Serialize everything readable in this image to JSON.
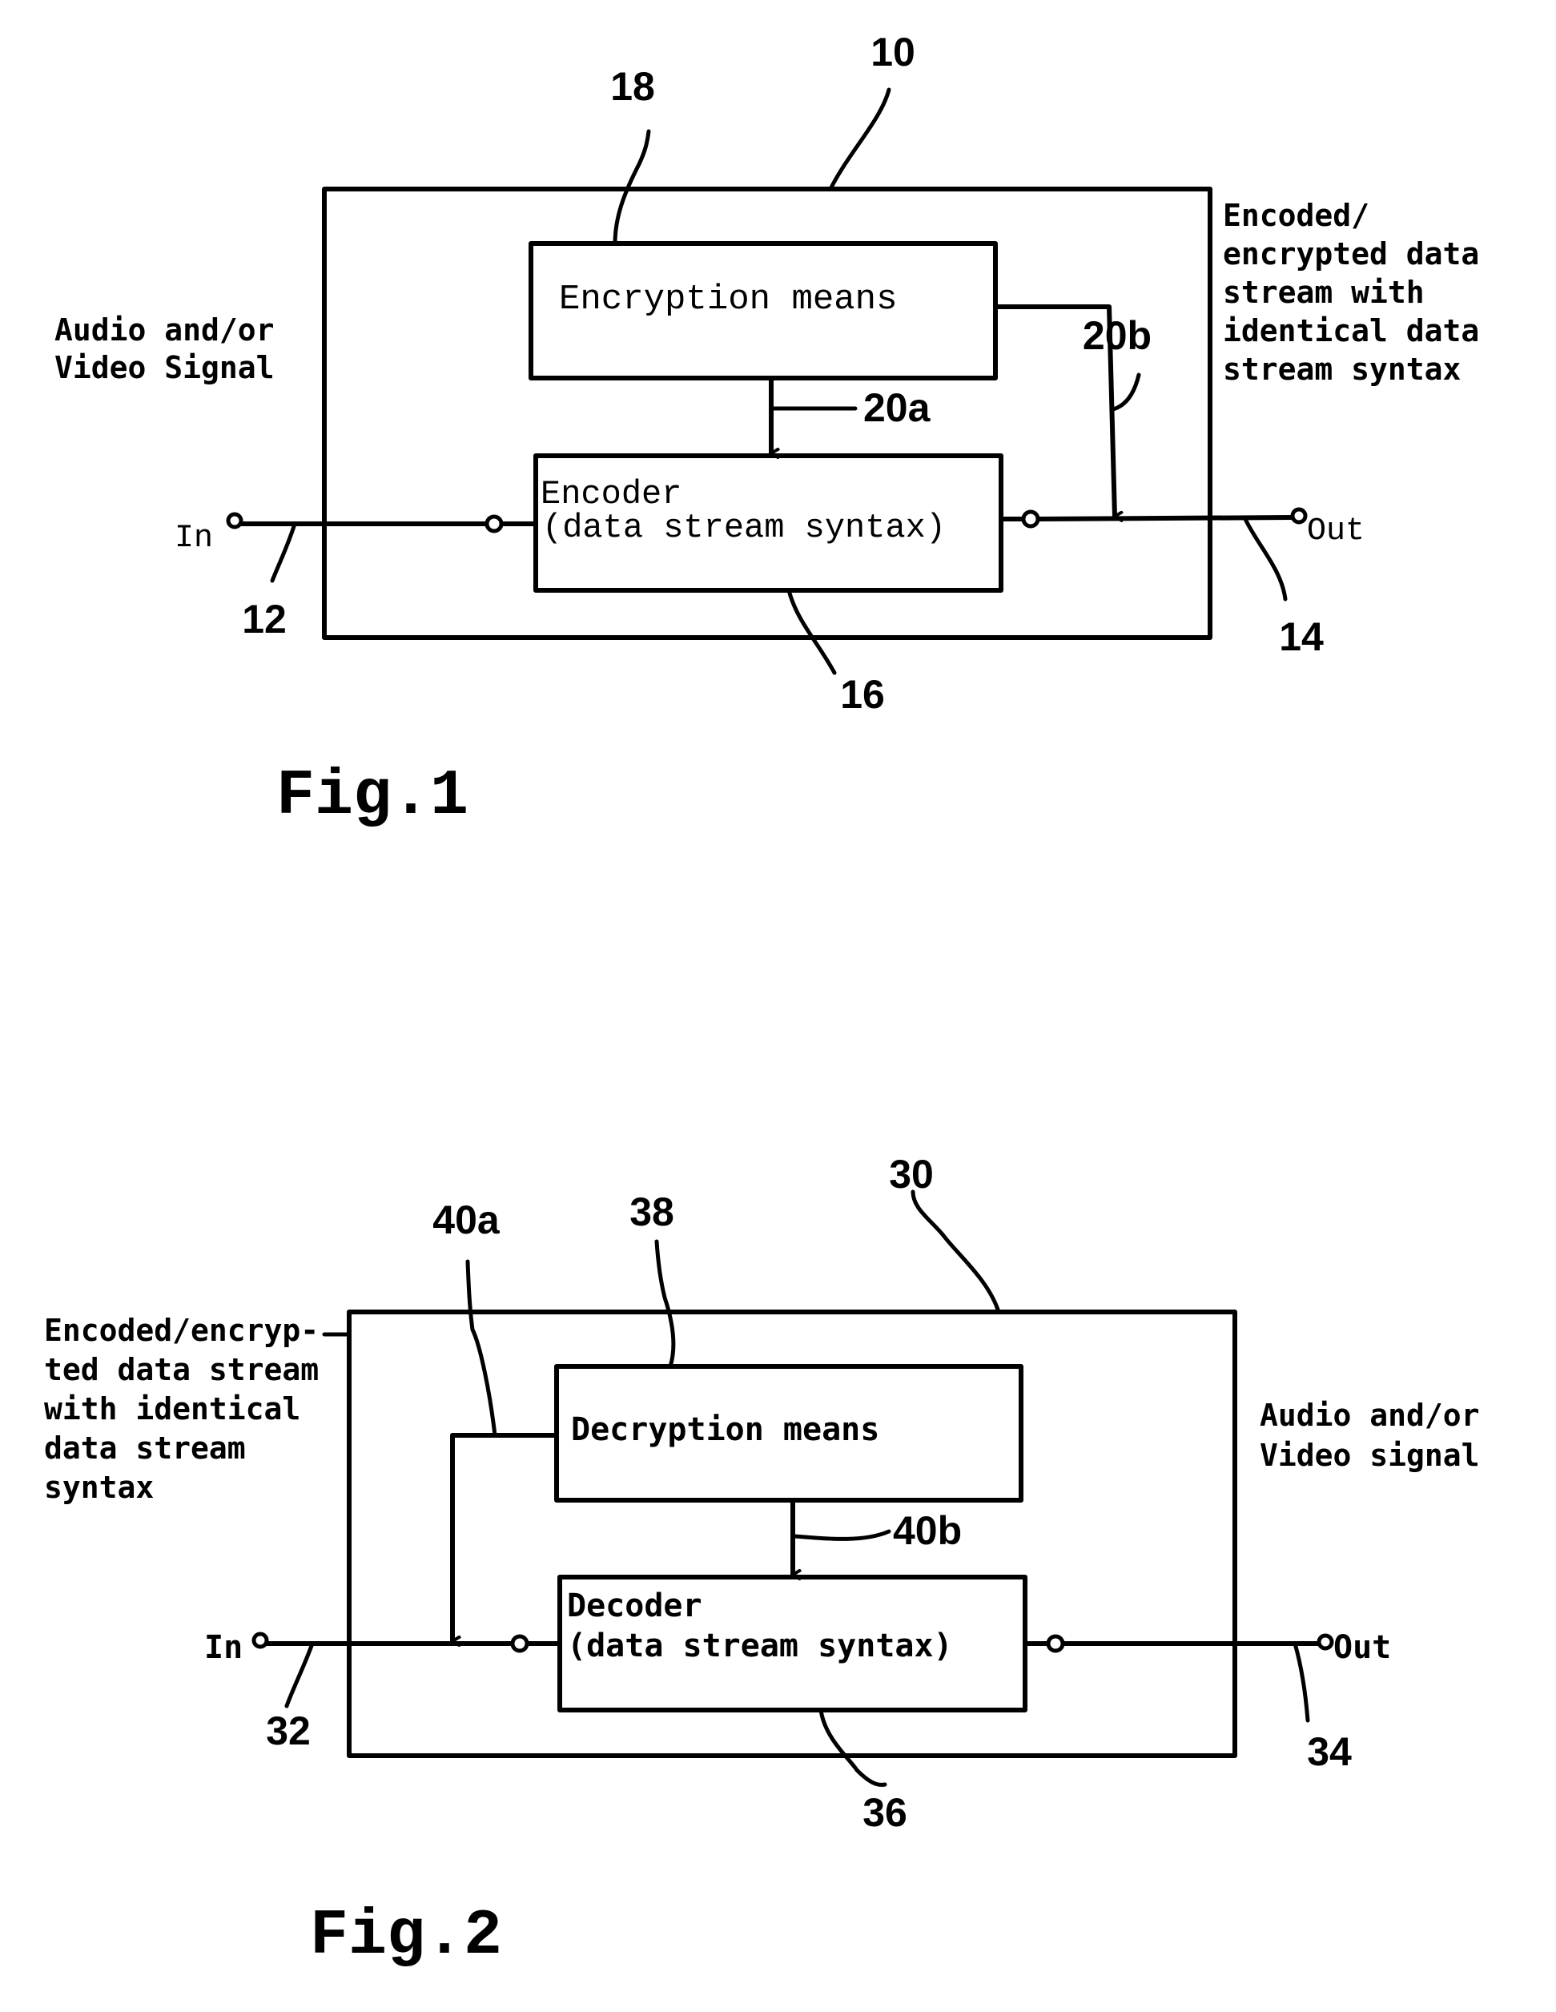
{
  "figure1": {
    "caption": "Fig.1",
    "refs": {
      "device": "10",
      "input": "12",
      "output": "14",
      "encoder": "16",
      "encryption": "18",
      "link_a": "20a",
      "link_b": "20b"
    },
    "blocks": {
      "encryption": "Encryption means",
      "encoder_line1": "Encoder",
      "encoder_line2": "(data stream syntax)"
    },
    "terminals": {
      "in": "In",
      "out": "Out"
    },
    "input_description": [
      "Audio and/or",
      "Video Signal"
    ],
    "output_description": [
      "Encoded/",
      "encrypted data",
      "stream with",
      "identical data",
      "stream syntax"
    ]
  },
  "figure2": {
    "caption": "Fig.2",
    "refs": {
      "device": "30",
      "input": "32",
      "output": "34",
      "decoder": "36",
      "decryption": "38",
      "link_a": "40a",
      "link_b": "40b"
    },
    "blocks": {
      "decryption": "Decryption means",
      "decoder_line1": "Decoder",
      "decoder_line2": "(data stream syntax)"
    },
    "terminals": {
      "in": "In",
      "out": "Out"
    },
    "input_description": [
      "Encoded/encryp-",
      "ted data stream",
      "with identical",
      "data stream",
      "syntax"
    ],
    "output_description": [
      "Audio and/or",
      "Video signal"
    ]
  }
}
